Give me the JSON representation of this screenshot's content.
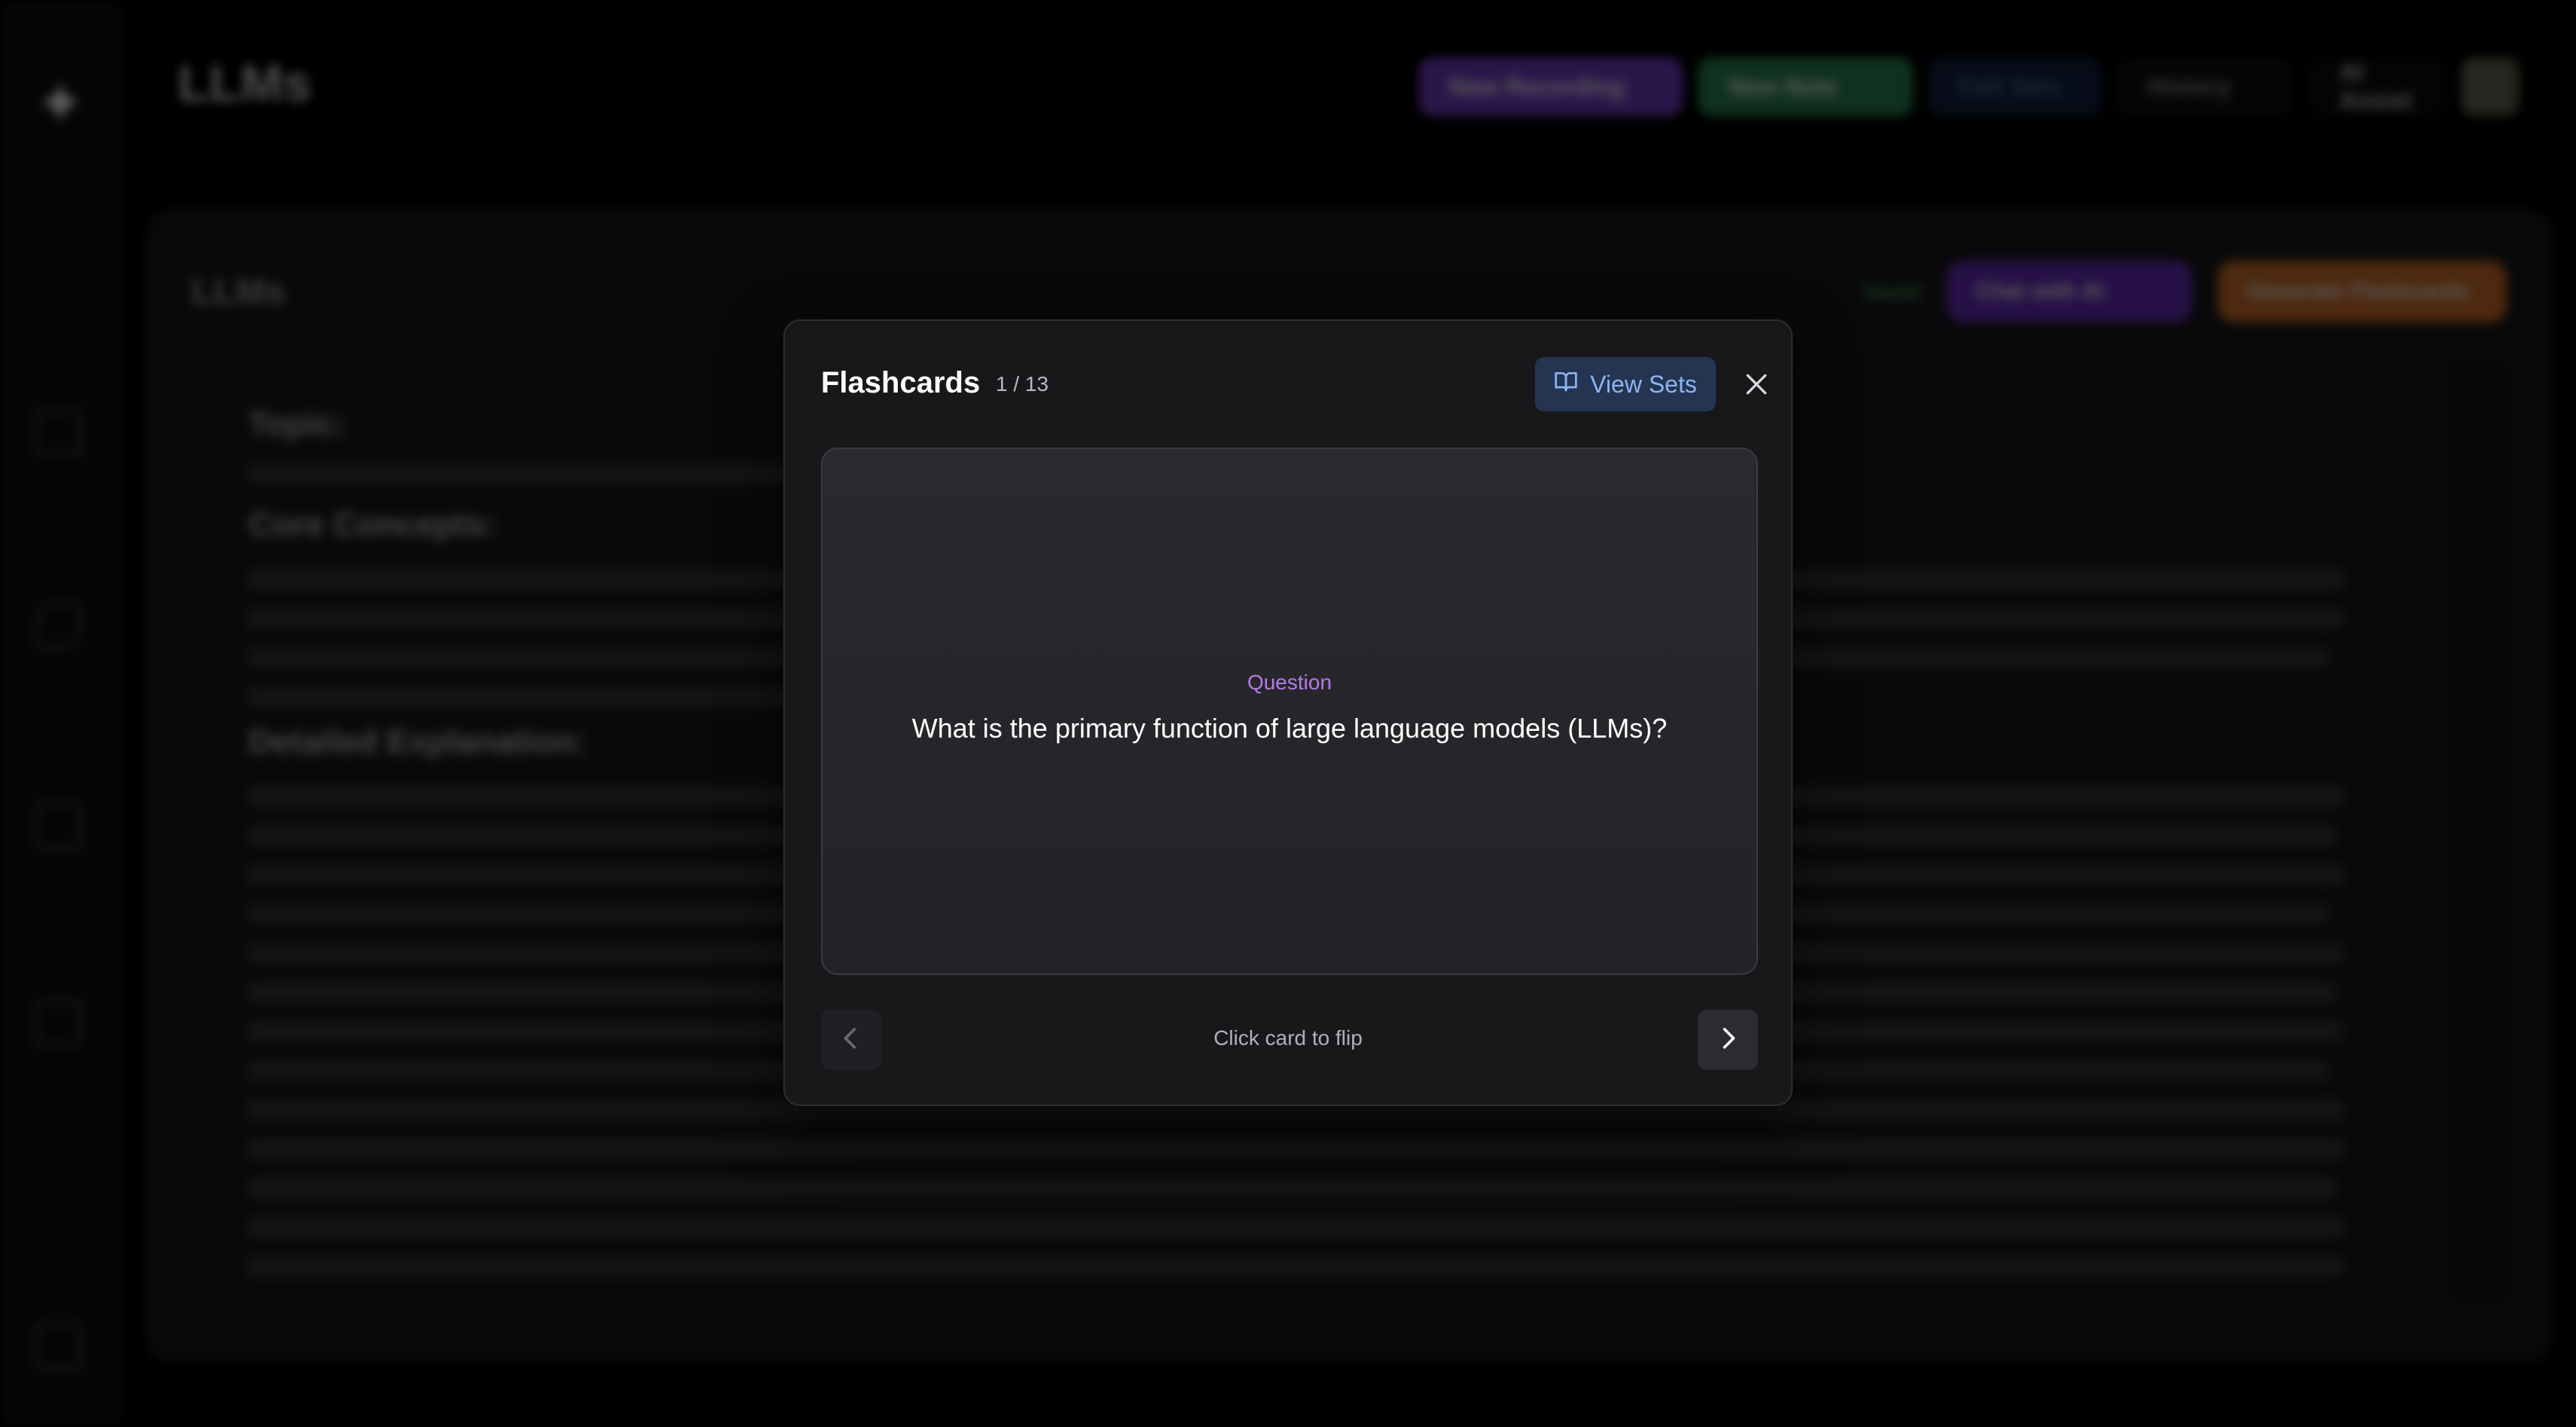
{
  "app": {
    "title": "LLMs"
  },
  "header": {
    "buttons": [
      "New Recording",
      "New Note",
      "Edit Sets",
      "History",
      "AI Assist"
    ]
  },
  "panel": {
    "title": "LLMs",
    "saved": "Saved",
    "actions": [
      "Chat with AI",
      "Generate Flashcards"
    ]
  },
  "document": {
    "headings": [
      "Topic:",
      "Core Concepts:",
      "Detailed Explanation:"
    ]
  },
  "modal": {
    "title": "Flashcards",
    "counter": "1 / 13",
    "view_sets_label": "View Sets",
    "card": {
      "label": "Question",
      "text": "What is the primary function of large language models (LLMs)?"
    },
    "flip_hint": "Click card to flip"
  },
  "colors": {
    "accent_purple": "#b37be8",
    "view_sets_bg": "#243552",
    "view_sets_text": "#8db4f2"
  },
  "icons": {
    "logo": "sparkle-icon",
    "view_sets": "book-open-icon",
    "close": "close-icon",
    "prev": "chevron-left-icon",
    "next": "chevron-right-icon"
  }
}
